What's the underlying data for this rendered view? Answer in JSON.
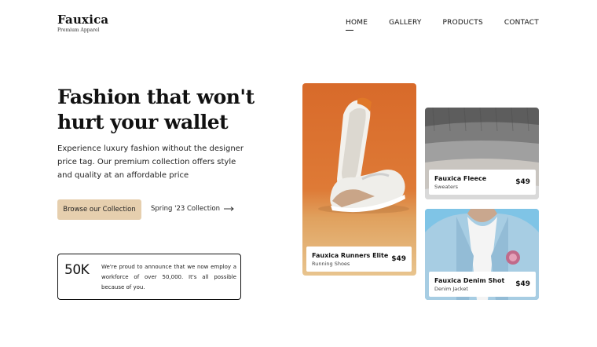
{
  "brand": {
    "name": "Fauxica",
    "tagline": "Premium Apparel"
  },
  "nav": {
    "items": [
      {
        "label": "HOME",
        "active": true
      },
      {
        "label": "GALLERY",
        "active": false
      },
      {
        "label": "PRODUCTS",
        "active": false
      },
      {
        "label": "CONTACT",
        "active": false
      }
    ]
  },
  "hero": {
    "title": "Fashion that won't hurt your wallet",
    "description": "Experience luxury fashion without the designer price tag. Our premium collection offers style and quality at an affordable price",
    "primary_button": "Browse our Collection",
    "secondary_link": "Spring '23 Collection"
  },
  "stat": {
    "number": "50K",
    "text": "We're proud to announce that we now employ a workforce of over 50,000. It's all possible because of you."
  },
  "products": [
    {
      "name": "Fauxica Runners Elite",
      "category": "Running Shoes",
      "price": "$49"
    },
    {
      "name": "Fauxica Fleece",
      "category": "Sweaters",
      "price": "$49"
    },
    {
      "name": "Fauxica Denim Shot",
      "category": "Denim Jacket",
      "price": "$49"
    }
  ],
  "colors": {
    "accent": "#e6cfae",
    "text": "#111111"
  }
}
